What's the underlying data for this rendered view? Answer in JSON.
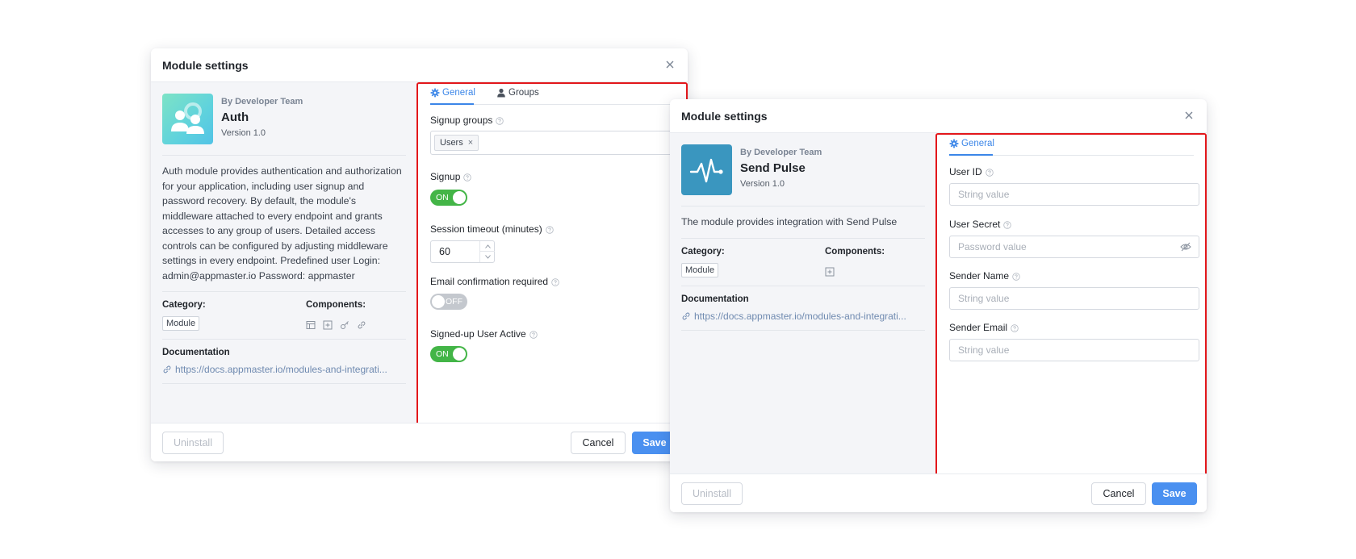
{
  "modal_auth": {
    "title": "Module settings",
    "module": {
      "by": "By Developer Team",
      "name": "Auth",
      "version": "Version 1.0",
      "description": "Auth module provides authentication and authorization for your application, including user signup and password recovery. By default, the module's middleware attached to every endpoint and grants accesses to any group of users. Detailed access controls can be configured by adjusting middleware settings in every endpoint. Predefined user Login: admin@appmaster.io Password: appmaster",
      "category_label": "Category:",
      "category_value": "Module",
      "components_label": "Components:",
      "component_icons": [
        "table-icon",
        "plus-square-icon",
        "key-icon",
        "link-icon"
      ],
      "documentation_label": "Documentation",
      "documentation_url": "https://docs.appmaster.io/modules-and-integrati..."
    },
    "tabs": [
      {
        "label": "General",
        "icon": "gear-icon",
        "active": true
      },
      {
        "label": "Groups",
        "icon": "user-icon",
        "active": false
      }
    ],
    "fields": {
      "signup_groups_label": "Signup groups",
      "signup_groups_tag": "Users",
      "signup_label": "Signup",
      "signup_state": "ON",
      "session_timeout_label": "Session timeout (minutes)",
      "session_timeout_value": "60",
      "email_confirmation_label": "Email confirmation required",
      "email_confirmation_state": "OFF",
      "signed_up_active_label": "Signed-up User Active",
      "signed_up_active_state": "ON"
    },
    "footer": {
      "uninstall": "Uninstall",
      "cancel": "Cancel",
      "save": "Save"
    }
  },
  "modal_pulse": {
    "title": "Module settings",
    "module": {
      "by": "By Developer Team",
      "name": "Send Pulse",
      "version": "Version 1.0",
      "description": "The module provides integration with Send Pulse",
      "category_label": "Category:",
      "category_value": "Module",
      "components_label": "Components:",
      "component_icons": [
        "plus-square-icon"
      ],
      "documentation_label": "Documentation",
      "documentation_url": "https://docs.appmaster.io/modules-and-integrati..."
    },
    "tabs": [
      {
        "label": "General",
        "icon": "gear-icon",
        "active": true
      }
    ],
    "fields": {
      "user_id_label": "User ID",
      "user_id_placeholder": "String value",
      "user_secret_label": "User Secret",
      "user_secret_placeholder": "Password value",
      "sender_name_label": "Sender Name",
      "sender_name_placeholder": "String value",
      "sender_email_label": "Sender Email",
      "sender_email_placeholder": "String value"
    },
    "footer": {
      "uninstall": "Uninstall",
      "cancel": "Cancel",
      "save": "Save"
    }
  },
  "colors": {
    "accent": "#3b86e8",
    "save_button": "#4a90f0",
    "toggle_on": "#43b547",
    "toggle_off": "#c4c8ce",
    "highlight_box": "#e3171b"
  }
}
